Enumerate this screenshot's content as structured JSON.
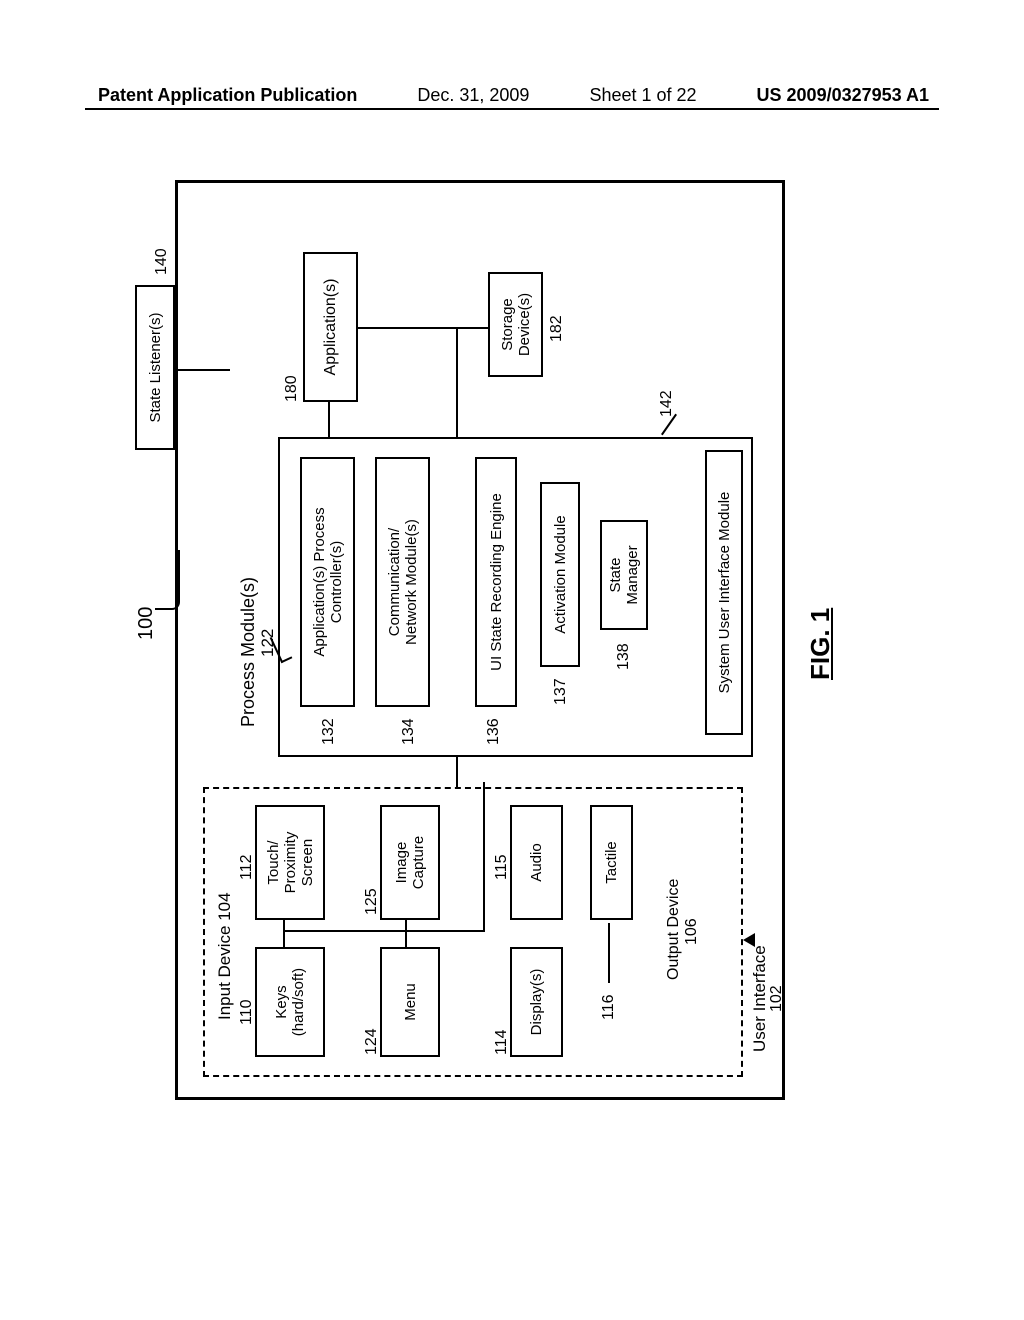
{
  "header": {
    "left": "Patent Application Publication",
    "date": "Dec. 31, 2009",
    "sheet": "Sheet 1 of 22",
    "pubno": "US 2009/0327953 A1"
  },
  "figure_label": "FIG. 1",
  "refs": {
    "r100": "100",
    "r102": "102",
    "r104": "Input Device 104",
    "r106": "106",
    "r110": "110",
    "r112": "112",
    "r114": "114",
    "r115": "115",
    "r116": "116",
    "r122": "122",
    "r124": "124",
    "r125": "125",
    "r132": "132",
    "r134": "134",
    "r136": "136",
    "r137": "137",
    "r138": "138",
    "r140": "140",
    "r142": "142",
    "r180": "180",
    "r182": "182"
  },
  "labels": {
    "user_interface": "User Interface",
    "output_device": "Output Device",
    "keys": "Keys\n(hard/soft)",
    "touch": "Touch/\nProximity\nScreen",
    "menu": "Menu",
    "image_capture": "Image\nCapture",
    "displays": "Display(s)",
    "audio": "Audio",
    "tactile": "Tactile",
    "process_modules": "Process Module(s)",
    "app_process_ctrl": "Application(s) Process\nController(s)",
    "comm_net": "Communication/\nNetwork Module(s)",
    "ui_state_rec": "UI State Recording Engine",
    "activation": "Activation Module",
    "state_mgr": "State\nManager",
    "sys_ui_mod": "System User Interface Module",
    "applications": "Application(s)",
    "state_listeners": "State Listener(s)",
    "storage": "Storage\nDevice(s)"
  }
}
